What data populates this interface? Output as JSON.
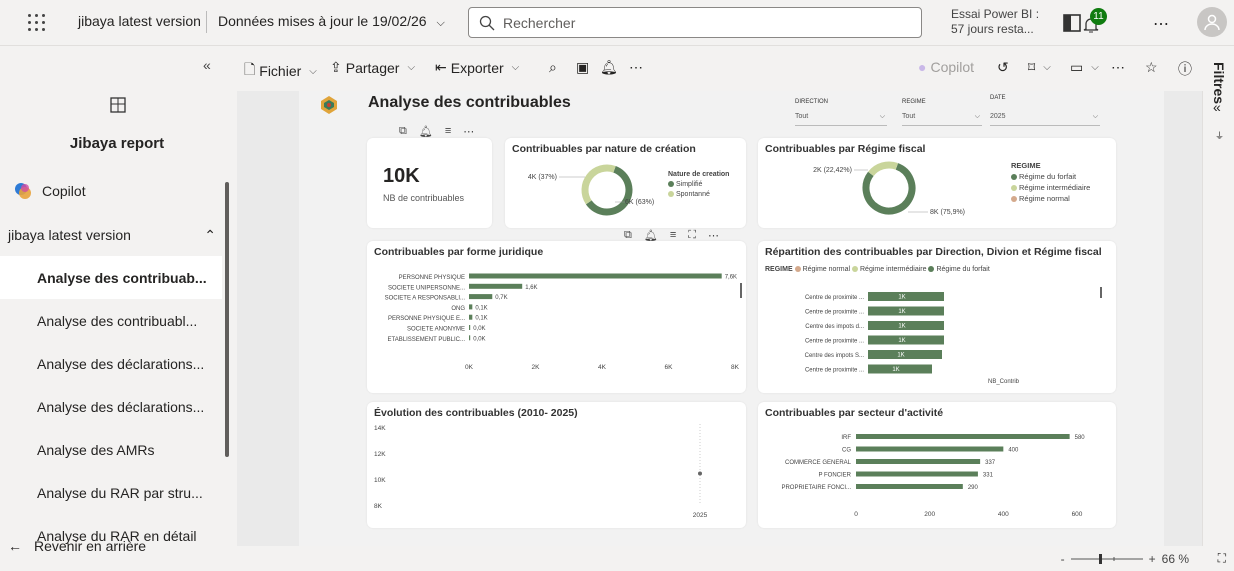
{
  "header": {
    "app_name": "jibaya latest version",
    "updated": "Données mises à jour le 19/02/26",
    "search_placeholder": "Rechercher",
    "trial_line1": "Essai Power BI :",
    "trial_line2": "57 jours resta...",
    "notif_count": "11"
  },
  "sidebar": {
    "report_title": "Jibaya report",
    "copilot": "Copilot",
    "group": "jibaya latest version",
    "items": [
      "Analyse des contribuab...",
      "Analyse des contribuabl...",
      "Analyse des déclarations...",
      "Analyse des déclarations...",
      "Analyse des AMRs",
      "Analyse du RAR par stru...",
      "Analyse du RAR en détail"
    ],
    "back": "Revenir en arrière"
  },
  "toolbar": {
    "file": "Fichier",
    "share": "Partager",
    "export": "Exporter",
    "copilot": "Copilot"
  },
  "report": {
    "title": "Analyse des contribuables",
    "slicers": [
      {
        "label": "DIRECTION",
        "value": "Tout"
      },
      {
        "label": "REGIME",
        "value": "Tout"
      },
      {
        "label": "DATE",
        "value": "2025"
      }
    ],
    "kpi": {
      "value": "10K",
      "label": "NB de contribuables"
    }
  },
  "filters_label": "Filtres",
  "zoom": "66 %",
  "colors": {
    "dark_green": "#5b7f5a",
    "light_green": "#c9d59b",
    "tan": "#d4a98c",
    "bar": "#5b7f5a"
  },
  "chart_data": [
    {
      "type": "pie",
      "title": "Contribuables par nature de création",
      "legend_title": "Nature de creation",
      "categories": [
        "Simplifié",
        "Spontanné"
      ],
      "values": [
        6,
        4
      ],
      "labels": [
        "6K (63%)",
        "4K (37%)"
      ]
    },
    {
      "type": "pie",
      "title": "Contribuables par Régime fiscal",
      "legend_title": "REGIME",
      "categories": [
        "Régime du forfait",
        "Régime intermédiaire",
        "Régime normal"
      ],
      "values": [
        8,
        2,
        0
      ],
      "labels": [
        "8K (75,9%)",
        "2K (22,42%)",
        ""
      ]
    },
    {
      "type": "bar",
      "title": "Contribuables par forme juridique",
      "categories": [
        "PERSONNE PHYSIQUE",
        "SOCIETE UNIPERSONNE...",
        "SOCIETE A RESPONSABLI...",
        "ONG",
        "PERSONNE PHYSIQUE E...",
        "SOCIETE ANONYME",
        "ETABLISSEMENT PUBLIC..."
      ],
      "values": [
        7.6,
        1.6,
        0.7,
        0.1,
        0.1,
        0.0,
        0.0
      ],
      "labels": [
        "7,6K",
        "1,6K",
        "0,7K",
        "0,1K",
        "0,1K",
        "0,0K",
        "0,0K"
      ],
      "xticks": [
        "0K",
        "2K",
        "4K",
        "6K",
        "8K"
      ],
      "xlim": [
        0,
        8
      ]
    },
    {
      "type": "bar",
      "title": "Répartition des contribuables par Direction, Divion et Régime fiscal",
      "legend_title": "REGIME",
      "series_names": [
        "Régime normal",
        "Régime intermédiaire",
        "Régime du forfait"
      ],
      "categories": [
        "Centre de proximite ...",
        "Centre de proximite ...",
        "Centre des impots d...",
        "Centre de proximite ...",
        "Centre des impots S...",
        "Centre de proximite ..."
      ],
      "values": [
        1,
        1,
        1,
        1,
        1,
        1
      ],
      "labels": [
        "1K",
        "1K",
        "1K",
        "1K",
        "1K",
        "1K"
      ],
      "xlabel": "NB_Contrib"
    },
    {
      "type": "line",
      "title": "Évolution des contribuables (2010- 2025)",
      "x": [
        "2025"
      ],
      "y": [
        10.5
      ],
      "yticks": [
        "14K",
        "12K",
        "10K",
        "8K"
      ],
      "ylim": [
        8,
        14
      ]
    },
    {
      "type": "bar",
      "title": "Contribuables par secteur d'activité",
      "categories": [
        "IRF",
        "CG",
        "COMMERCE GENERAL",
        "P FONCIER",
        "PROPRIETAIRE FONCI..."
      ],
      "values": [
        580,
        400,
        337,
        331,
        290
      ],
      "labels": [
        "580",
        "400",
        "337",
        "331",
        "290"
      ],
      "xticks": [
        "0",
        "200",
        "400",
        "600"
      ],
      "xlim": [
        0,
        600
      ]
    }
  ]
}
